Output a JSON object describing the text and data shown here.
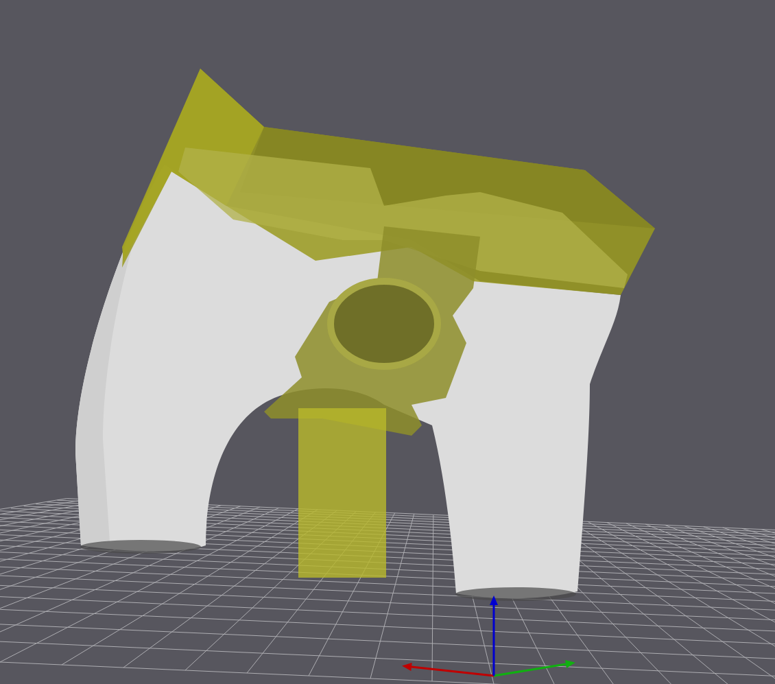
{
  "viewport": {
    "axes": [
      {
        "kind": "x",
        "color": "#c00000"
      },
      {
        "kind": "y",
        "color": "#10b010"
      },
      {
        "kind": "z",
        "color": "#0000d0"
      }
    ]
  }
}
